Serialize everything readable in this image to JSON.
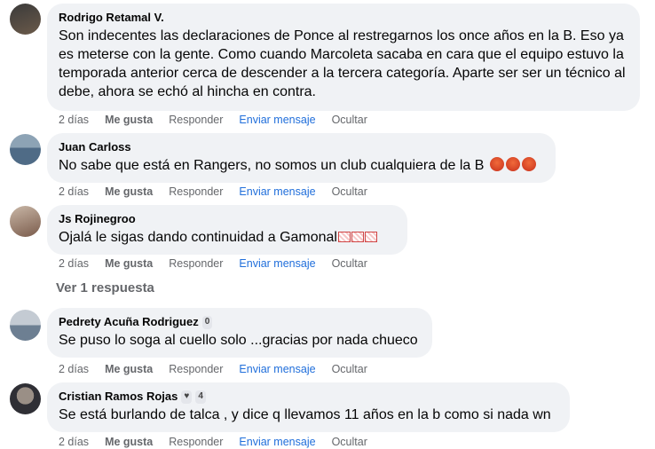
{
  "comments": [
    {
      "author": "Rodrigo Retamal V.",
      "text": "Son indecentes las declaraciones de Ponce al restregarnos los once años en la B. Eso ya es meterse con la gente. Como cuando Marcoleta sacaba en cara que el equipo estuvo la temporada anterior cerca de descender a la tercera categoría. Aparte ser ser un técnico al debe, ahora se echó al hincha en contra.",
      "time": "2 días",
      "like": "Me gusta",
      "reply": "Responder",
      "message": "Enviar mensaje",
      "hide": "Ocultar",
      "avatar_colors": [
        "#3a3a3a",
        "#6b5a4a"
      ]
    },
    {
      "author": "Juan Carloss",
      "text": "No sabe que está en Rangers, no somos un club cualquiera de la B",
      "emojis": [
        "angry-face-icon",
        "angry-face-icon",
        "angry-face-icon"
      ],
      "time": "2 días",
      "like": "Me gusta",
      "reply": "Responder",
      "message": "Enviar mensaje",
      "hide": "Ocultar",
      "avatar_colors": [
        "#4f6b86",
        "#8da3b5"
      ]
    },
    {
      "author": "Js Rojinegroo",
      "text": "Ojalá le sigas dando continuidad a Gamonal",
      "emojis": [
        "flag-icon",
        "flag-icon",
        "flag-icon"
      ],
      "time": "2 días",
      "like": "Me gusta",
      "reply": "Responder",
      "message": "Enviar mensaje",
      "hide": "Ocultar",
      "avatar_colors": [
        "#7a5b4b",
        "#c9b7a7"
      ]
    },
    {
      "author": "Pedrety Acuña Rodriguez",
      "badge": "0",
      "text": "Se puso lo soga al cuello solo ...gracias por nada chueco",
      "time": "2 días",
      "like": "Me gusta",
      "reply": "Responder",
      "message": "Enviar mensaje",
      "hide": "Ocultar",
      "avatar_colors": [
        "#6d7f92",
        "#c4cbd3"
      ]
    },
    {
      "author": "Cristian Ramos Rojas",
      "badge": "4",
      "text": "Se está burlando de talca , y dice q llevamos 11 años en la b como si nada wn",
      "time": "2 días",
      "like": "Me gusta",
      "reply": "Responder",
      "message": "Enviar mensaje",
      "hide": "Ocultar",
      "avatar_colors": [
        "#2f2f35",
        "#9a8f86"
      ]
    }
  ],
  "view_replies": "Ver 1 respuesta",
  "colors": {
    "bubble": "#f0f2f5",
    "link": "#216fdb",
    "secondary_text": "#65676b"
  }
}
